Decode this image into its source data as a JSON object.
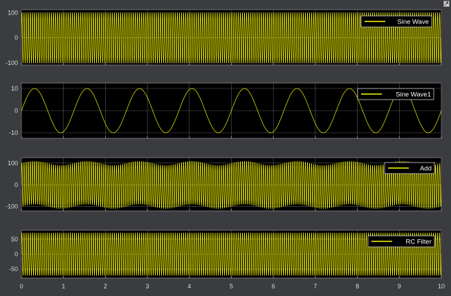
{
  "window": {
    "background": "#3a3c40",
    "axes_background": "#000000",
    "grid_color": "#5a5a5a",
    "trace_color": "#ffff00",
    "tick_label_color": "#d8d8d8",
    "icons": [
      "undock-icon"
    ]
  },
  "chart_data": [
    {
      "type": "line",
      "x_ticks": [
        0,
        1,
        2,
        3,
        4,
        5,
        6,
        7,
        8,
        9,
        10
      ],
      "x_tick_labels": [
        "0",
        "1",
        "2",
        "3",
        "4",
        "5",
        "6",
        "7",
        "8",
        "9",
        "10"
      ],
      "xlim": [
        0,
        10
      ],
      "ylim": [
        -108,
        112
      ],
      "y_ticks": [
        -100,
        0,
        100
      ],
      "y_tick_labels": [
        "-100",
        "0",
        "100"
      ],
      "grid": true,
      "legend_position": "top-right",
      "series": [
        {
          "name": "Sine Wave",
          "color": "#ffff00",
          "amplitude": 100,
          "frequency_hz": 20,
          "offset": 0
        }
      ]
    },
    {
      "type": "line",
      "x_ticks": [
        0,
        1,
        2,
        3,
        4,
        5,
        6,
        7,
        8,
        9,
        10
      ],
      "x_tick_labels": [
        "0",
        "1",
        "2",
        "3",
        "4",
        "5",
        "6",
        "7",
        "8",
        "9",
        "10"
      ],
      "xlim": [
        0,
        10
      ],
      "ylim": [
        -12.5,
        12.5
      ],
      "y_ticks": [
        -10,
        0,
        10
      ],
      "y_tick_labels": [
        "-10",
        "0",
        "10"
      ],
      "grid": true,
      "legend_position": "top-right",
      "series": [
        {
          "name": "Sine Wave1",
          "color": "#ffff00",
          "amplitude": 10,
          "frequency_hz": 0.8,
          "offset": 0
        }
      ]
    },
    {
      "type": "line",
      "x_ticks": [
        0,
        1,
        2,
        3,
        4,
        5,
        6,
        7,
        8,
        9,
        10
      ],
      "x_tick_labels": [
        "0",
        "1",
        "2",
        "3",
        "4",
        "5",
        "6",
        "7",
        "8",
        "9",
        "10"
      ],
      "xlim": [
        0,
        10
      ],
      "ylim": [
        -120,
        125
      ],
      "y_ticks": [
        -100,
        0,
        100
      ],
      "y_tick_labels": [
        "-100",
        "0",
        "100"
      ],
      "grid": true,
      "legend_position": "top-right",
      "series": [
        {
          "name": "Add",
          "color": "#ffff00",
          "amplitude": 100,
          "frequency_hz": 20,
          "modulation_amplitude": 10,
          "modulation_frequency_hz": 0.8
        }
      ]
    },
    {
      "type": "line",
      "x_ticks": [
        0,
        1,
        2,
        3,
        4,
        5,
        6,
        7,
        8,
        9,
        10
      ],
      "x_tick_labels": [
        "0",
        "1",
        "2",
        "3",
        "4",
        "5",
        "6",
        "7",
        "8",
        "9",
        "10"
      ],
      "xlim": [
        0,
        10
      ],
      "ylim": [
        -80,
        80
      ],
      "y_ticks": [
        -50,
        0,
        50
      ],
      "y_tick_labels": [
        "-50",
        "0",
        "50"
      ],
      "grid": true,
      "legend_position": "top-right",
      "series": [
        {
          "name": "RC Filter",
          "color": "#ffff00",
          "amplitude": 72,
          "frequency_hz": 20,
          "offset": 0
        }
      ]
    }
  ]
}
